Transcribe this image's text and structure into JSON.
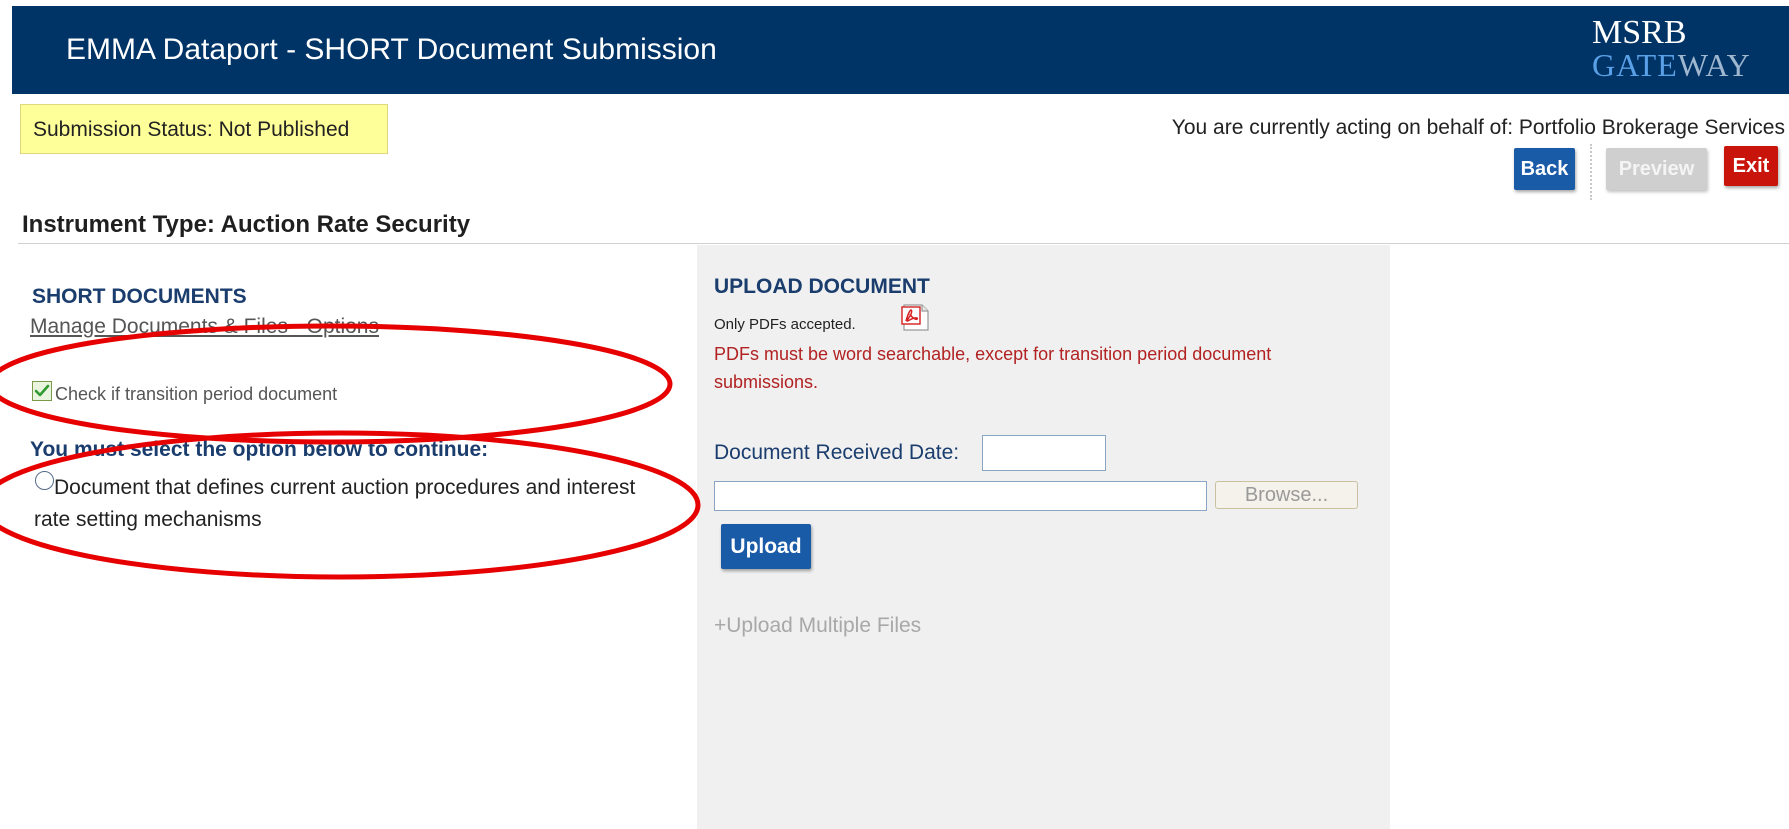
{
  "header": {
    "title": "EMMA Dataport - SHORT Document Submission",
    "logo_top": "MSRB",
    "logo_bottom_part1": "GATE",
    "logo_bottom_part2": "WAY"
  },
  "status": {
    "label": "Submission Status: Not Published"
  },
  "behalf": {
    "text": "You are currently acting on behalf of: Portfolio Brokerage Services"
  },
  "toolbar": {
    "back_label": "Back",
    "preview_label": "Preview",
    "exit_label": "Exit"
  },
  "instrument": {
    "heading": "Instrument Type: Auction Rate Security"
  },
  "short_documents": {
    "title": "SHORT DOCUMENTS",
    "manage_link": "Manage Documents & Files - Options",
    "transition_label": "Check if transition period document",
    "transition_checked": true,
    "must_select": "You must select the option below to continue:",
    "option_label": "Document that defines current auction procedures and interest rate setting mechanisms",
    "option_selected": false
  },
  "upload": {
    "title": "UPLOAD DOCUMENT",
    "only_pdfs": "Only PDFs accepted.",
    "pdf_icon": "pdf-icon",
    "warning": "PDFs must be word searchable, except for transition period document submissions.",
    "received_date_label": "Document Received Date:",
    "received_date_value": "",
    "file_path_value": "",
    "browse_label": "Browse...",
    "upload_label": "Upload",
    "multiple_link": "+Upload Multiple Files"
  },
  "colors": {
    "header_bg": "#003366",
    "status_bg": "#ffff99",
    "primary_button": "#1a5ba8",
    "exit_button": "#c8140a",
    "annotation": "#e60000",
    "panel_bg": "#f0f0f0",
    "warning_text": "#b22222"
  }
}
